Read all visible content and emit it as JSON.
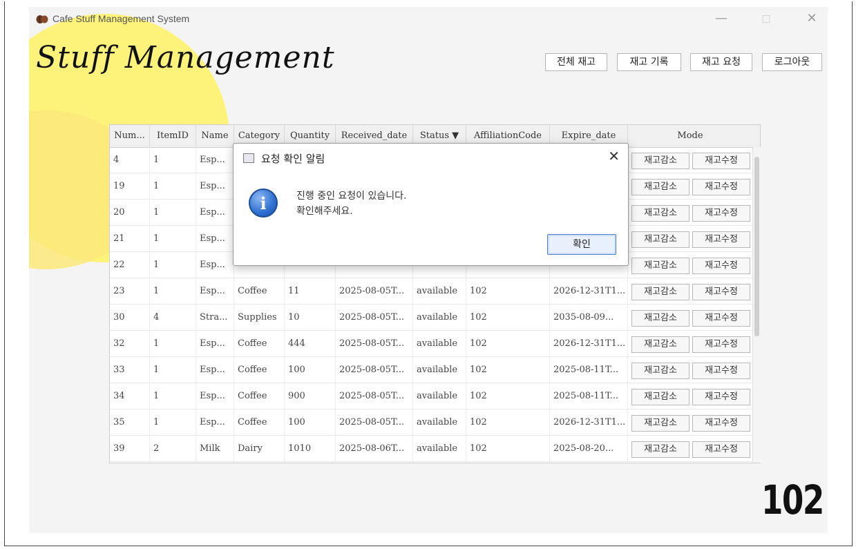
{
  "window": {
    "title": "Cafe Stuff Management System",
    "minimize": "—",
    "maximize": "□",
    "close": "✕"
  },
  "header": {
    "logo_text": "Stuff Management",
    "nav": [
      "전체 재고",
      "재고 기록",
      "재고 요청",
      "로그아웃"
    ]
  },
  "table": {
    "columns": [
      "Num...",
      "ItemID",
      "Name",
      "Category",
      "Quantity",
      "Received_date",
      "Status ▼",
      "AffiliationCode",
      "Expire_date",
      "Mode"
    ],
    "rows": [
      {
        "num": "4",
        "item_id": "1",
        "name": "Esp...",
        "category": "",
        "quantity": "",
        "received": "",
        "status": "",
        "affiliation": "",
        "expire": ""
      },
      {
        "num": "19",
        "item_id": "1",
        "name": "Esp...",
        "category": "",
        "quantity": "",
        "received": "",
        "status": "",
        "affiliation": "",
        "expire": ""
      },
      {
        "num": "20",
        "item_id": "1",
        "name": "Esp...",
        "category": "",
        "quantity": "",
        "received": "",
        "status": "",
        "affiliation": "",
        "expire": ""
      },
      {
        "num": "21",
        "item_id": "1",
        "name": "Esp...",
        "category": "",
        "quantity": "",
        "received": "",
        "status": "",
        "affiliation": "",
        "expire": ""
      },
      {
        "num": "22",
        "item_id": "1",
        "name": "Esp...",
        "category": "",
        "quantity": "",
        "received": "",
        "status": "",
        "affiliation": "",
        "expire": ""
      },
      {
        "num": "23",
        "item_id": "1",
        "name": "Esp...",
        "category": "Coffee",
        "quantity": "11",
        "received": "2025-08-05T...",
        "status": "available",
        "affiliation": "102",
        "expire": "2026-12-31T1..."
      },
      {
        "num": "30",
        "item_id": "4",
        "name": "Stra...",
        "category": "Supplies",
        "quantity": "10",
        "received": "2025-08-05T...",
        "status": "available",
        "affiliation": "102",
        "expire": "2035-08-09..."
      },
      {
        "num": "32",
        "item_id": "1",
        "name": "Esp...",
        "category": "Coffee",
        "quantity": "444",
        "received": "2025-08-05T...",
        "status": "available",
        "affiliation": "102",
        "expire": "2026-12-31T1..."
      },
      {
        "num": "33",
        "item_id": "1",
        "name": "Esp...",
        "category": "Coffee",
        "quantity": "100",
        "received": "2025-08-05T...",
        "status": "available",
        "affiliation": "102",
        "expire": "2025-08-11T..."
      },
      {
        "num": "34",
        "item_id": "1",
        "name": "Esp...",
        "category": "Coffee",
        "quantity": "900",
        "received": "2025-08-05T...",
        "status": "available",
        "affiliation": "102",
        "expire": "2025-08-11T..."
      },
      {
        "num": "35",
        "item_id": "1",
        "name": "Esp...",
        "category": "Coffee",
        "quantity": "100",
        "received": "2025-08-05T...",
        "status": "available",
        "affiliation": "102",
        "expire": "2026-12-31T1..."
      },
      {
        "num": "39",
        "item_id": "2",
        "name": "Milk",
        "category": "Dairy",
        "quantity": "1010",
        "received": "2025-08-06T...",
        "status": "available",
        "affiliation": "102",
        "expire": "2025-08-20..."
      }
    ],
    "mode_buttons": [
      "재고감소",
      "재고수정"
    ]
  },
  "affiliation_display": "102",
  "dialog": {
    "title": "요청 확인 알림",
    "close": "✕",
    "icon": "i",
    "message": "진행 중인 요청이 있습니다.\n확인해주세요.",
    "ok_label": "확인"
  }
}
